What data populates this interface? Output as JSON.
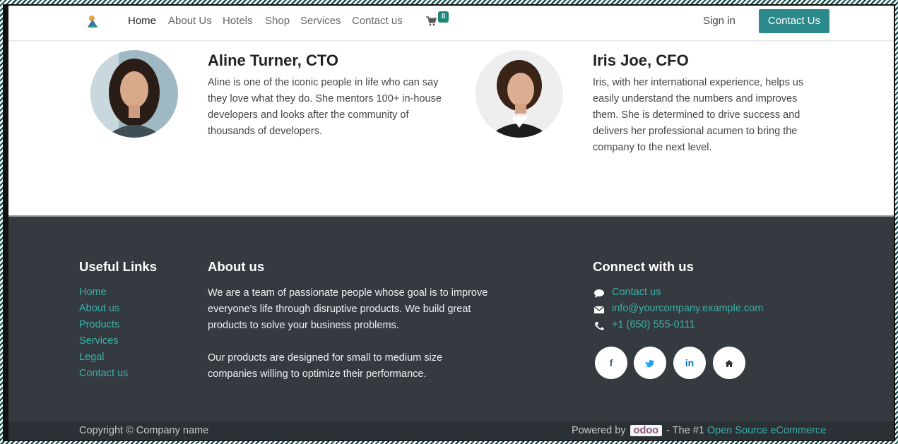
{
  "nav": {
    "items": [
      "Home",
      "About Us",
      "Hotels",
      "Shop",
      "Services",
      "Contact us"
    ],
    "cart_count": "0",
    "signin": "Sign in",
    "contact_button": "Contact Us"
  },
  "team": [
    {
      "name": "Aline Turner, CTO",
      "bio": "Aline is one of the iconic people in life who can say they love what they do. She mentors 100+ in-house developers and looks after the community of thousands of developers."
    },
    {
      "name": "Iris Joe, CFO",
      "bio": "Iris, with her international experience, helps us easily understand the numbers and improves them. She is determined to drive success and delivers her professional acumen to bring the company to the next level."
    }
  ],
  "footer": {
    "useful_links": {
      "title": "Useful Links",
      "items": [
        "Home",
        "About us",
        "Products",
        "Services",
        "Legal",
        "Contact us"
      ]
    },
    "about": {
      "title": "About us",
      "p1": "We are a team of passionate people whose goal is to improve everyone's life through disruptive products. We build great products to solve your business problems.",
      "p2": "Our products are designed for small to medium size companies willing to optimize their performance."
    },
    "connect": {
      "title": "Connect with us",
      "contact": "Contact us",
      "email": "info@yourcompany.example.com",
      "phone": "+1 (650) 555-0111",
      "social": [
        "f",
        "in"
      ]
    },
    "copyright": "Copyright © Company name",
    "powered_prefix": "Powered by",
    "powered_brand": "odoo",
    "powered_middle": "- The #1",
    "powered_link": "Open Source eCommerce"
  },
  "colors": {
    "accent": "#2d8a8c",
    "link": "#3ab0a8",
    "footer_bg": "#343a40"
  }
}
